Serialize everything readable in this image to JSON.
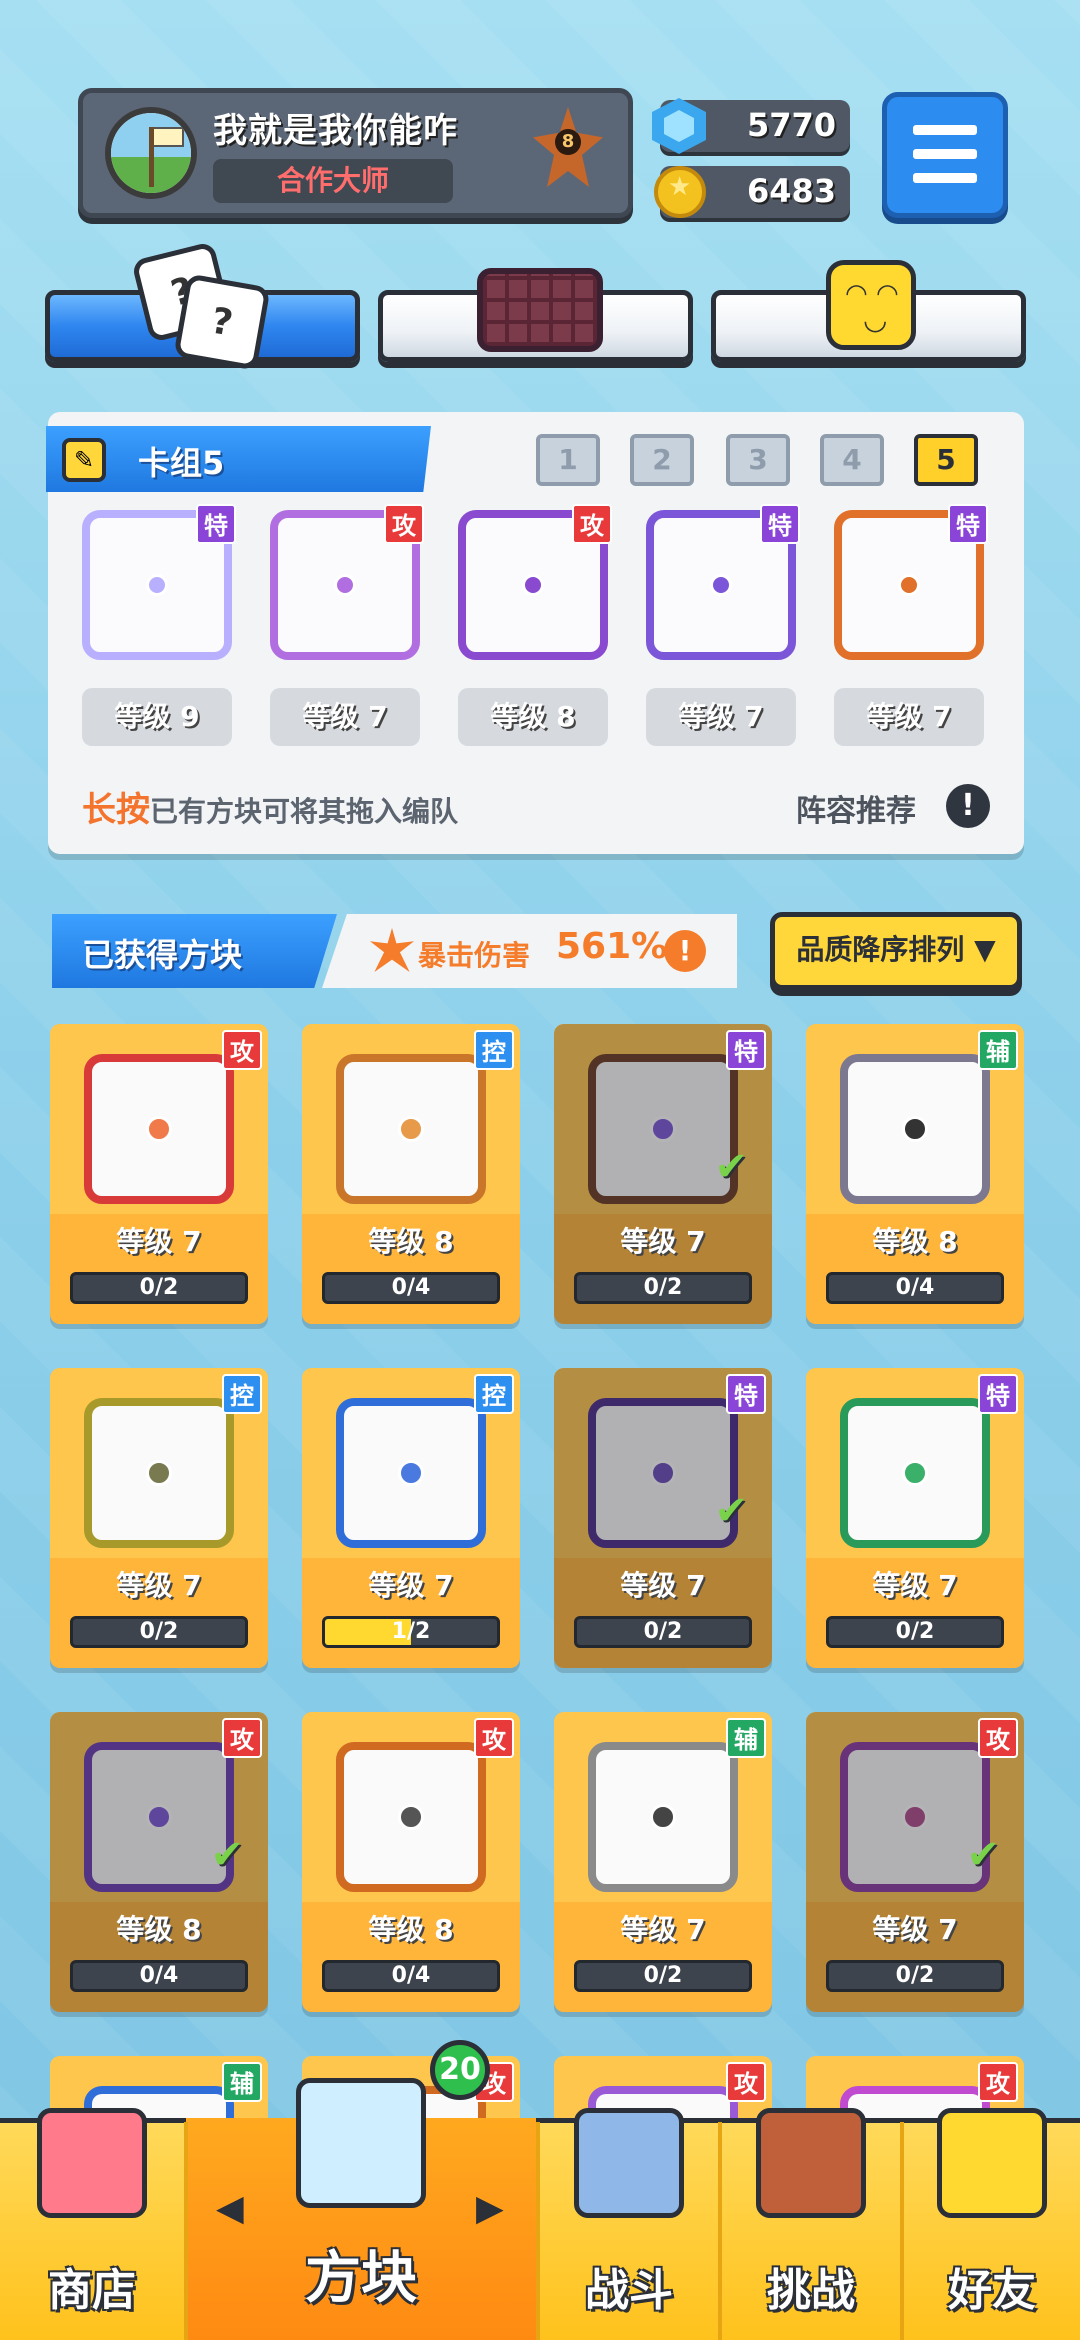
{
  "header": {
    "player_name": "我就是我你能咋",
    "player_title": "合作大师",
    "rank_level": "8",
    "gems": "5770",
    "coins": "6483"
  },
  "deck": {
    "title": "卡组5",
    "deck_numbers": [
      "1",
      "2",
      "3",
      "4",
      "5"
    ],
    "active_deck": "5",
    "slots": [
      {
        "tag": "特",
        "level": "等级 9",
        "color": "#b8b0ff"
      },
      {
        "tag": "攻",
        "level": "等级 7",
        "color": "#b16ee0"
      },
      {
        "tag": "攻",
        "level": "等级 8",
        "color": "#8a4ad0"
      },
      {
        "tag": "特",
        "level": "等级 7",
        "color": "#7b56d8"
      },
      {
        "tag": "特",
        "level": "等级 7",
        "color": "#e0702a"
      }
    ],
    "hint_prefix": "长按",
    "hint_rest": "已有方块可将其拖入编队",
    "recommend": "阵容推荐",
    "recommend_icon": "!"
  },
  "acquired": {
    "title": "已获得方块",
    "crit_label": "暴击伤害",
    "crit_value": "561%",
    "crit_icon": "!",
    "sort_label": "品质降序排列 ▼"
  },
  "cards": [
    {
      "tag": "攻",
      "tag_color": "#e83a3a",
      "border": "#d83a3a",
      "dot": "#f07a4a",
      "level": "等级 7",
      "progress": "0/2",
      "fill": 0,
      "checked": false,
      "dim": false
    },
    {
      "tag": "控",
      "tag_color": "#2d8ff0",
      "border": "#c9762a",
      "dot": "#e69a4a",
      "level": "等级 8",
      "progress": "0/4",
      "fill": 0,
      "checked": false,
      "dim": false
    },
    {
      "tag": "特",
      "tag_color": "#8a45d8",
      "border": "#6a3a20",
      "dot": "#7b56d8",
      "level": "等级 7",
      "progress": "0/2",
      "fill": 0,
      "checked": true,
      "dim": true
    },
    {
      "tag": "辅",
      "tag_color": "#22a863",
      "border": "#7c7890",
      "dot": "#333",
      "level": "等级 8",
      "progress": "0/4",
      "fill": 0,
      "checked": false,
      "dim": false
    },
    {
      "tag": "控",
      "tag_color": "#2d8ff0",
      "border": "#a89a2a",
      "dot": "#7a7a50",
      "level": "等级 7",
      "progress": "0/2",
      "fill": 0,
      "checked": false,
      "dim": false
    },
    {
      "tag": "控",
      "tag_color": "#2d8ff0",
      "border": "#2f6ed8",
      "dot": "#4a7ae0",
      "level": "等级 7",
      "progress": "1/2",
      "fill": 0.5,
      "checked": false,
      "dim": false
    },
    {
      "tag": "特",
      "tag_color": "#8a45d8",
      "border": "#4a2a8a",
      "dot": "#6a4ab8",
      "level": "等级 7",
      "progress": "0/2",
      "fill": 0,
      "checked": true,
      "dim": true
    },
    {
      "tag": "特",
      "tag_color": "#8a45d8",
      "border": "#2a9a5a",
      "dot": "#3ab06a",
      "level": "等级 7",
      "progress": "0/2",
      "fill": 0,
      "checked": false,
      "dim": false
    },
    {
      "tag": "攻",
      "tag_color": "#e83a3a",
      "border": "#6a3ab0",
      "dot": "#7b56d8",
      "level": "等级 8",
      "progress": "0/4",
      "fill": 0,
      "checked": true,
      "dim": true
    },
    {
      "tag": "攻",
      "tag_color": "#e83a3a",
      "border": "#d06a20",
      "dot": "#555",
      "level": "等级 8",
      "progress": "0/4",
      "fill": 0,
      "checked": false,
      "dim": false
    },
    {
      "tag": "辅",
      "tag_color": "#22a863",
      "border": "#8a8a8a",
      "dot": "#444",
      "level": "等级 7",
      "progress": "0/2",
      "fill": 0,
      "checked": false,
      "dim": false
    },
    {
      "tag": "攻",
      "tag_color": "#e83a3a",
      "border": "#8a3aa0",
      "dot": "#b04a8a",
      "level": "等级 7",
      "progress": "0/2",
      "fill": 0,
      "checked": true,
      "dim": true
    }
  ],
  "partial_row": [
    {
      "tag": "辅",
      "tag_color": "#22a863",
      "border": "#2f6ed8"
    },
    {
      "tag": "攻",
      "tag_color": "#e83a3a",
      "border": "#d06a20"
    },
    {
      "tag": "攻",
      "tag_color": "#e83a3a",
      "border": "#9a5ad6"
    },
    {
      "tag": "攻",
      "tag_color": "#e83a3a",
      "border": "#c04ad0"
    }
  ],
  "nav": {
    "shop": "商店",
    "blocks": "方块",
    "battle": "战斗",
    "challenge": "挑战",
    "friends": "好友",
    "blocks_badge": "20"
  },
  "icons": {
    "top_tab_1": "dice-icon",
    "top_tab_2": "board-icon",
    "top_tab_3": "smiley-icon"
  }
}
